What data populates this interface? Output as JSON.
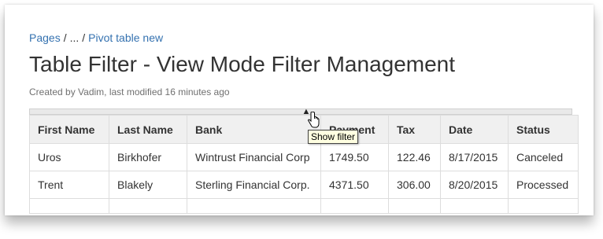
{
  "breadcrumb": {
    "root": "Pages",
    "separator": "/",
    "ellipsis": "...",
    "current": "Pivot table new"
  },
  "page": {
    "title": "Table Filter - View Mode Filter Management",
    "meta": "Created by Vadim, last modified 16 minutes ago"
  },
  "filter": {
    "tooltip": "Show filter",
    "toggle_icon": "chevron-up-icon",
    "cursor_icon": "hand-pointer-icon"
  },
  "table": {
    "headers": [
      "First Name",
      "Last Name",
      "Bank",
      "Payment",
      "Tax",
      "Date",
      "Status"
    ],
    "rows": [
      [
        "Uros",
        "Birkhofer",
        "Wintrust Financial Corp",
        "1749.50",
        "122.46",
        "8/17/2015",
        "Canceled"
      ],
      [
        "Trent",
        "Blakely",
        "Sterling Financial Corp.",
        "4371.50",
        "306.00",
        "8/20/2015",
        "Processed"
      ]
    ]
  }
}
